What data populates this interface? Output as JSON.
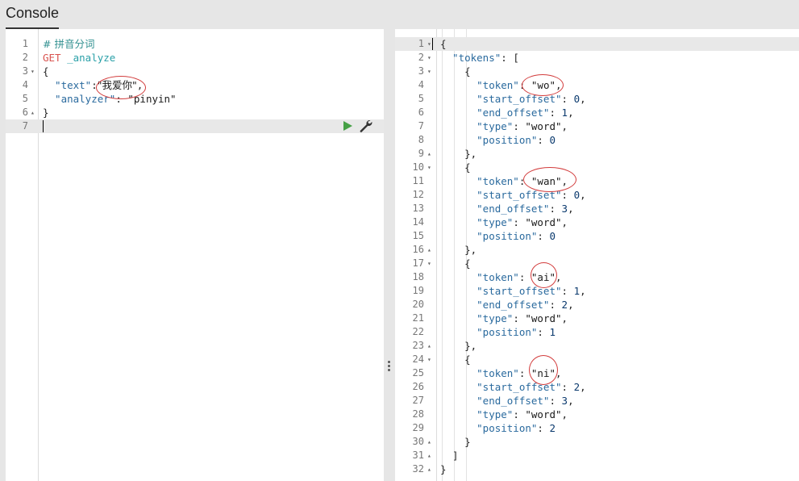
{
  "header": {
    "tab_label": "Console"
  },
  "request": {
    "lines": [
      {
        "n": "1",
        "fold": "",
        "parts": [
          {
            "t": "# 拼音分词",
            "c": "c-comment c-zh"
          }
        ]
      },
      {
        "n": "2",
        "fold": "",
        "parts": [
          {
            "t": "GET ",
            "c": "c-method"
          },
          {
            "t": "_analyze",
            "c": "c-url"
          }
        ]
      },
      {
        "n": "3",
        "fold": "▾",
        "parts": [
          {
            "t": "{",
            "c": "c-punc"
          }
        ]
      },
      {
        "n": "4",
        "fold": "",
        "parts": [
          {
            "t": "  \"text\"",
            "c": "c-key"
          },
          {
            "t": ":",
            "c": "c-punc"
          },
          {
            "t": "\"我爱你\"",
            "c": "c-str c-zh"
          },
          {
            "t": ",",
            "c": "c-punc"
          }
        ]
      },
      {
        "n": "5",
        "fold": "",
        "parts": [
          {
            "t": "  \"analyzer\"",
            "c": "c-key"
          },
          {
            "t": ": ",
            "c": "c-punc"
          },
          {
            "t": "\"pinyin\"",
            "c": "c-str"
          }
        ]
      },
      {
        "n": "6",
        "fold": "▴",
        "parts": [
          {
            "t": "}",
            "c": "c-punc"
          }
        ]
      },
      {
        "n": "7",
        "fold": "",
        "parts": []
      }
    ]
  },
  "response": {
    "lines": [
      {
        "n": "1",
        "fold": "▾",
        "parts": [
          {
            "t": "{",
            "c": "c-punc"
          }
        ]
      },
      {
        "n": "2",
        "fold": "▾",
        "parts": [
          {
            "t": "  \"tokens\"",
            "c": "c-key"
          },
          {
            "t": ": [",
            "c": "c-punc"
          }
        ]
      },
      {
        "n": "3",
        "fold": "▾",
        "parts": [
          {
            "t": "    {",
            "c": "c-punc"
          }
        ]
      },
      {
        "n": "4",
        "fold": "",
        "parts": [
          {
            "t": "      \"token\"",
            "c": "c-key"
          },
          {
            "t": ": ",
            "c": "c-punc"
          },
          {
            "t": "\"wo\"",
            "c": "c-str"
          },
          {
            "t": ",",
            "c": "c-punc"
          }
        ]
      },
      {
        "n": "5",
        "fold": "",
        "parts": [
          {
            "t": "      \"start_offset\"",
            "c": "c-key"
          },
          {
            "t": ": ",
            "c": "c-punc"
          },
          {
            "t": "0",
            "c": "c-num"
          },
          {
            "t": ",",
            "c": "c-punc"
          }
        ]
      },
      {
        "n": "6",
        "fold": "",
        "parts": [
          {
            "t": "      \"end_offset\"",
            "c": "c-key"
          },
          {
            "t": ": ",
            "c": "c-punc"
          },
          {
            "t": "1",
            "c": "c-num"
          },
          {
            "t": ",",
            "c": "c-punc"
          }
        ]
      },
      {
        "n": "7",
        "fold": "",
        "parts": [
          {
            "t": "      \"type\"",
            "c": "c-key"
          },
          {
            "t": ": ",
            "c": "c-punc"
          },
          {
            "t": "\"word\"",
            "c": "c-str"
          },
          {
            "t": ",",
            "c": "c-punc"
          }
        ]
      },
      {
        "n": "8",
        "fold": "",
        "parts": [
          {
            "t": "      \"position\"",
            "c": "c-key"
          },
          {
            "t": ": ",
            "c": "c-punc"
          },
          {
            "t": "0",
            "c": "c-num"
          }
        ]
      },
      {
        "n": "9",
        "fold": "▴",
        "parts": [
          {
            "t": "    },",
            "c": "c-punc"
          }
        ]
      },
      {
        "n": "10",
        "fold": "▾",
        "parts": [
          {
            "t": "    {",
            "c": "c-punc"
          }
        ]
      },
      {
        "n": "11",
        "fold": "",
        "parts": [
          {
            "t": "      \"token\"",
            "c": "c-key"
          },
          {
            "t": ": ",
            "c": "c-punc"
          },
          {
            "t": "\"wan\"",
            "c": "c-str"
          },
          {
            "t": ",",
            "c": "c-punc"
          }
        ]
      },
      {
        "n": "12",
        "fold": "",
        "parts": [
          {
            "t": "      \"start_offset\"",
            "c": "c-key"
          },
          {
            "t": ": ",
            "c": "c-punc"
          },
          {
            "t": "0",
            "c": "c-num"
          },
          {
            "t": ",",
            "c": "c-punc"
          }
        ]
      },
      {
        "n": "13",
        "fold": "",
        "parts": [
          {
            "t": "      \"end_offset\"",
            "c": "c-key"
          },
          {
            "t": ": ",
            "c": "c-punc"
          },
          {
            "t": "3",
            "c": "c-num"
          },
          {
            "t": ",",
            "c": "c-punc"
          }
        ]
      },
      {
        "n": "14",
        "fold": "",
        "parts": [
          {
            "t": "      \"type\"",
            "c": "c-key"
          },
          {
            "t": ": ",
            "c": "c-punc"
          },
          {
            "t": "\"word\"",
            "c": "c-str"
          },
          {
            "t": ",",
            "c": "c-punc"
          }
        ]
      },
      {
        "n": "15",
        "fold": "",
        "parts": [
          {
            "t": "      \"position\"",
            "c": "c-key"
          },
          {
            "t": ": ",
            "c": "c-punc"
          },
          {
            "t": "0",
            "c": "c-num"
          }
        ]
      },
      {
        "n": "16",
        "fold": "▴",
        "parts": [
          {
            "t": "    },",
            "c": "c-punc"
          }
        ]
      },
      {
        "n": "17",
        "fold": "▾",
        "parts": [
          {
            "t": "    {",
            "c": "c-punc"
          }
        ]
      },
      {
        "n": "18",
        "fold": "",
        "parts": [
          {
            "t": "      \"token\"",
            "c": "c-key"
          },
          {
            "t": ": ",
            "c": "c-punc"
          },
          {
            "t": "\"ai\"",
            "c": "c-str"
          },
          {
            "t": ",",
            "c": "c-punc"
          }
        ]
      },
      {
        "n": "19",
        "fold": "",
        "parts": [
          {
            "t": "      \"start_offset\"",
            "c": "c-key"
          },
          {
            "t": ": ",
            "c": "c-punc"
          },
          {
            "t": "1",
            "c": "c-num"
          },
          {
            "t": ",",
            "c": "c-punc"
          }
        ]
      },
      {
        "n": "20",
        "fold": "",
        "parts": [
          {
            "t": "      \"end_offset\"",
            "c": "c-key"
          },
          {
            "t": ": ",
            "c": "c-punc"
          },
          {
            "t": "2",
            "c": "c-num"
          },
          {
            "t": ",",
            "c": "c-punc"
          }
        ]
      },
      {
        "n": "21",
        "fold": "",
        "parts": [
          {
            "t": "      \"type\"",
            "c": "c-key"
          },
          {
            "t": ": ",
            "c": "c-punc"
          },
          {
            "t": "\"word\"",
            "c": "c-str"
          },
          {
            "t": ",",
            "c": "c-punc"
          }
        ]
      },
      {
        "n": "22",
        "fold": "",
        "parts": [
          {
            "t": "      \"position\"",
            "c": "c-key"
          },
          {
            "t": ": ",
            "c": "c-punc"
          },
          {
            "t": "1",
            "c": "c-num"
          }
        ]
      },
      {
        "n": "23",
        "fold": "▴",
        "parts": [
          {
            "t": "    },",
            "c": "c-punc"
          }
        ]
      },
      {
        "n": "24",
        "fold": "▾",
        "parts": [
          {
            "t": "    {",
            "c": "c-punc"
          }
        ]
      },
      {
        "n": "25",
        "fold": "",
        "parts": [
          {
            "t": "      \"token\"",
            "c": "c-key"
          },
          {
            "t": ": ",
            "c": "c-punc"
          },
          {
            "t": "\"ni\"",
            "c": "c-str"
          },
          {
            "t": ",",
            "c": "c-punc"
          }
        ]
      },
      {
        "n": "26",
        "fold": "",
        "parts": [
          {
            "t": "      \"start_offset\"",
            "c": "c-key"
          },
          {
            "t": ": ",
            "c": "c-punc"
          },
          {
            "t": "2",
            "c": "c-num"
          },
          {
            "t": ",",
            "c": "c-punc"
          }
        ]
      },
      {
        "n": "27",
        "fold": "",
        "parts": [
          {
            "t": "      \"end_offset\"",
            "c": "c-key"
          },
          {
            "t": ": ",
            "c": "c-punc"
          },
          {
            "t": "3",
            "c": "c-num"
          },
          {
            "t": ",",
            "c": "c-punc"
          }
        ]
      },
      {
        "n": "28",
        "fold": "",
        "parts": [
          {
            "t": "      \"type\"",
            "c": "c-key"
          },
          {
            "t": ": ",
            "c": "c-punc"
          },
          {
            "t": "\"word\"",
            "c": "c-str"
          },
          {
            "t": ",",
            "c": "c-punc"
          }
        ]
      },
      {
        "n": "29",
        "fold": "",
        "parts": [
          {
            "t": "      \"position\"",
            "c": "c-key"
          },
          {
            "t": ": ",
            "c": "c-punc"
          },
          {
            "t": "2",
            "c": "c-num"
          }
        ]
      },
      {
        "n": "30",
        "fold": "▴",
        "parts": [
          {
            "t": "    }",
            "c": "c-punc"
          }
        ]
      },
      {
        "n": "31",
        "fold": "▴",
        "parts": [
          {
            "t": "  ]",
            "c": "c-punc"
          }
        ]
      },
      {
        "n": "32",
        "fold": "▴",
        "parts": [
          {
            "t": "}",
            "c": "c-punc"
          }
        ]
      }
    ]
  },
  "toolbar": {
    "run_icon": "play-icon",
    "settings_icon": "wrench-icon",
    "run_color": "#45a045"
  },
  "annotations": {
    "color": "#d23c3c"
  }
}
